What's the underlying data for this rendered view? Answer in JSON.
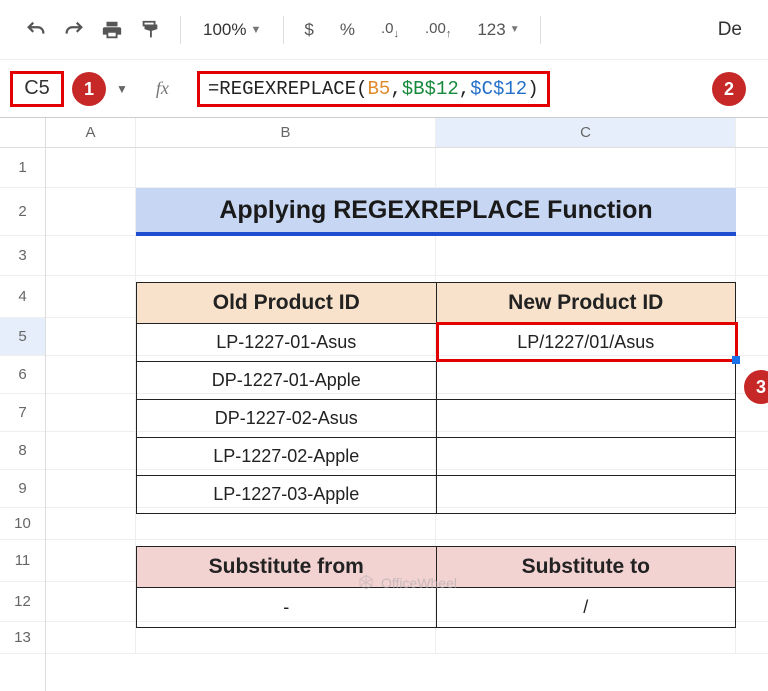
{
  "toolbar": {
    "zoom": "100%",
    "num_format": "123",
    "right_text": "De"
  },
  "formula_bar": {
    "cell_ref": "C5",
    "fx_label": "fx",
    "formula_prefix": "=REGEXREPLACE(",
    "formula_arg1": "B5",
    "formula_comma1": ",",
    "formula_arg2": "$B$12",
    "formula_comma2": ",",
    "formula_arg3": "$C$12",
    "formula_suffix": ")"
  },
  "callouts": {
    "one": "1",
    "two": "2",
    "three": "3"
  },
  "columns": {
    "A": "A",
    "B": "B",
    "C": "C"
  },
  "rows": [
    "1",
    "2",
    "3",
    "4",
    "5",
    "6",
    "7",
    "8",
    "9",
    "10",
    "11",
    "12",
    "13"
  ],
  "title": "Applying REGEXREPLACE Function",
  "products": {
    "headers": {
      "old": "Old Product ID",
      "new": "New Product ID"
    },
    "rows": [
      {
        "old": "LP-1227-01-Asus",
        "new": "LP/1227/01/Asus"
      },
      {
        "old": "DP-1227-01-Apple",
        "new": ""
      },
      {
        "old": "DP-1227-02-Asus",
        "new": ""
      },
      {
        "old": "LP-1227-02-Apple",
        "new": ""
      },
      {
        "old": "LP-1227-03-Apple",
        "new": ""
      }
    ]
  },
  "substitute": {
    "headers": {
      "from": "Substitute from",
      "to": "Substitute to"
    },
    "row": {
      "from": "-",
      "to": "/"
    }
  },
  "watermark": "OfficeWheel"
}
